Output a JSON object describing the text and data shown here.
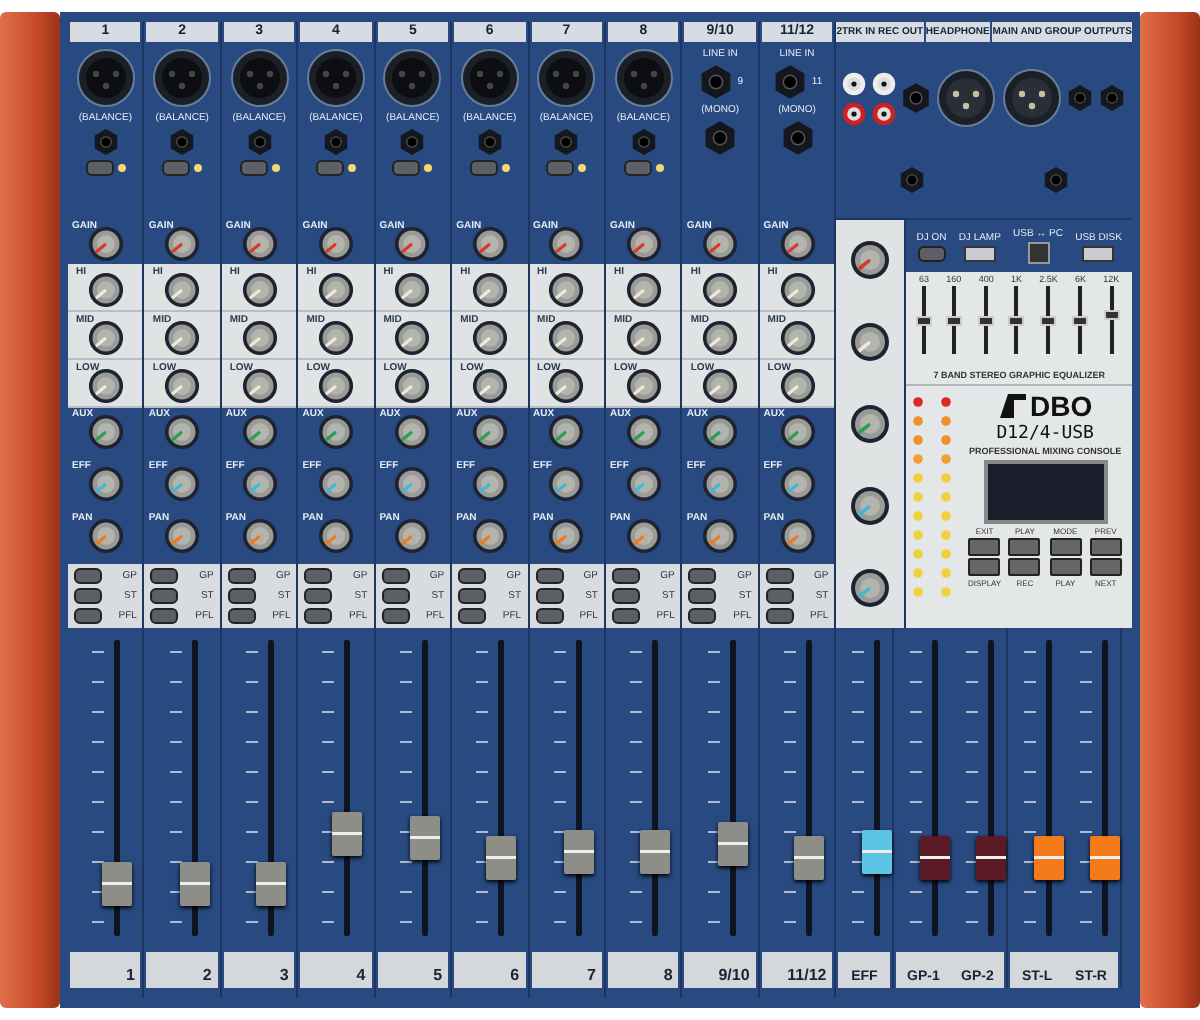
{
  "channels": [
    {
      "kind": "mono",
      "header": "1",
      "jack_label": "(BALANCE)",
      "pad_on": false,
      "knobs": [
        {
          "label": "GAIN",
          "kind": "gain",
          "color": "#d83a2a"
        },
        {
          "label": "HI",
          "kind": "eq",
          "color": "#efe8d8"
        },
        {
          "label": "MID",
          "kind": "eq",
          "color": "#efe8d8"
        },
        {
          "label": "LOW",
          "kind": "eq",
          "color": "#efe8d8"
        },
        {
          "label": "AUX",
          "kind": "send",
          "color": "#2aa050"
        },
        {
          "label": "EFF",
          "kind": "send",
          "color": "#40b8d8"
        },
        {
          "label": "PAN",
          "kind": "send",
          "color": "#f07a20"
        }
      ],
      "buttons": [
        {
          "label": "GP",
          "on": false
        },
        {
          "label": "ST",
          "on": false
        },
        {
          "label": "PFL",
          "on": false
        }
      ],
      "fader": {
        "level": 0.12
      },
      "label": "1"
    },
    {
      "kind": "mono",
      "header": "2",
      "jack_label": "(BALANCE)",
      "pad_on": false,
      "knobs": [
        {
          "label": "GAIN",
          "kind": "gain",
          "color": "#d83a2a"
        },
        {
          "label": "HI",
          "kind": "eq",
          "color": "#efe8d8"
        },
        {
          "label": "MID",
          "kind": "eq",
          "color": "#efe8d8"
        },
        {
          "label": "LOW",
          "kind": "eq",
          "color": "#efe8d8"
        },
        {
          "label": "AUX",
          "kind": "send",
          "color": "#2aa050"
        },
        {
          "label": "EFF",
          "kind": "send",
          "color": "#40b8d8"
        },
        {
          "label": "PAN",
          "kind": "send",
          "color": "#f07a20"
        }
      ],
      "buttons": [
        {
          "label": "GP",
          "on": false
        },
        {
          "label": "ST",
          "on": false
        },
        {
          "label": "PFL",
          "on": false
        }
      ],
      "fader": {
        "level": 0.12
      },
      "label": "2"
    },
    {
      "kind": "mono",
      "header": "3",
      "jack_label": "(BALANCE)",
      "pad_on": false,
      "knobs": [
        {
          "label": "GAIN",
          "kind": "gain",
          "color": "#d83a2a"
        },
        {
          "label": "HI",
          "kind": "eq",
          "color": "#efe8d8"
        },
        {
          "label": "MID",
          "kind": "eq",
          "color": "#efe8d8"
        },
        {
          "label": "LOW",
          "kind": "eq",
          "color": "#efe8d8"
        },
        {
          "label": "AUX",
          "kind": "send",
          "color": "#2aa050"
        },
        {
          "label": "EFF",
          "kind": "send",
          "color": "#40b8d8"
        },
        {
          "label": "PAN",
          "kind": "send",
          "color": "#f07a20"
        }
      ],
      "buttons": [
        {
          "label": "GP",
          "on": false
        },
        {
          "label": "ST",
          "on": false
        },
        {
          "label": "PFL",
          "on": false
        }
      ],
      "fader": {
        "level": 0.12
      },
      "label": "3"
    },
    {
      "kind": "mono",
      "header": "4",
      "jack_label": "(BALANCE)",
      "pad_on": false,
      "knobs": [
        {
          "label": "GAIN",
          "kind": "gain",
          "color": "#d83a2a"
        },
        {
          "label": "HI",
          "kind": "eq",
          "color": "#efe8d8"
        },
        {
          "label": "MID",
          "kind": "eq",
          "color": "#efe8d8"
        },
        {
          "label": "LOW",
          "kind": "eq",
          "color": "#efe8d8"
        },
        {
          "label": "AUX",
          "kind": "send",
          "color": "#2aa050"
        },
        {
          "label": "EFF",
          "kind": "send",
          "color": "#40b8d8"
        },
        {
          "label": "PAN",
          "kind": "send",
          "color": "#f07a20"
        }
      ],
      "buttons": [
        {
          "label": "GP",
          "on": false
        },
        {
          "label": "ST",
          "on": false
        },
        {
          "label": "PFL",
          "on": false
        }
      ],
      "fader": {
        "level": 0.32
      },
      "label": "4"
    },
    {
      "kind": "mono",
      "header": "5",
      "jack_label": "(BALANCE)",
      "pad_on": false,
      "knobs": [
        {
          "label": "GAIN",
          "kind": "gain",
          "color": "#d83a2a"
        },
        {
          "label": "HI",
          "kind": "eq",
          "color": "#efe8d8"
        },
        {
          "label": "MID",
          "kind": "eq",
          "color": "#efe8d8"
        },
        {
          "label": "LOW",
          "kind": "eq",
          "color": "#efe8d8"
        },
        {
          "label": "AUX",
          "kind": "send",
          "color": "#2aa050"
        },
        {
          "label": "EFF",
          "kind": "send",
          "color": "#40b8d8"
        },
        {
          "label": "PAN",
          "kind": "send",
          "color": "#f07a20"
        }
      ],
      "buttons": [
        {
          "label": "GP",
          "on": false
        },
        {
          "label": "ST",
          "on": false
        },
        {
          "label": "PFL",
          "on": false
        }
      ],
      "fader": {
        "level": 0.3
      },
      "label": "5"
    },
    {
      "kind": "mono",
      "header": "6",
      "jack_label": "(BALANCE)",
      "pad_on": false,
      "knobs": [
        {
          "label": "GAIN",
          "kind": "gain",
          "color": "#d83a2a"
        },
        {
          "label": "HI",
          "kind": "eq",
          "color": "#efe8d8"
        },
        {
          "label": "MID",
          "kind": "eq",
          "color": "#efe8d8"
        },
        {
          "label": "LOW",
          "kind": "eq",
          "color": "#efe8d8"
        },
        {
          "label": "AUX",
          "kind": "send",
          "color": "#2aa050"
        },
        {
          "label": "EFF",
          "kind": "send",
          "color": "#40b8d8"
        },
        {
          "label": "PAN",
          "kind": "send",
          "color": "#f07a20"
        }
      ],
      "buttons": [
        {
          "label": "GP",
          "on": false
        },
        {
          "label": "ST",
          "on": false
        },
        {
          "label": "PFL",
          "on": false
        }
      ],
      "fader": {
        "level": 0.22
      },
      "label": "6"
    },
    {
      "kind": "mono",
      "header": "7",
      "jack_label": "(BALANCE)",
      "pad_on": false,
      "knobs": [
        {
          "label": "GAIN",
          "kind": "gain",
          "color": "#d83a2a"
        },
        {
          "label": "HI",
          "kind": "eq",
          "color": "#efe8d8"
        },
        {
          "label": "MID",
          "kind": "eq",
          "color": "#efe8d8"
        },
        {
          "label": "LOW",
          "kind": "eq",
          "color": "#efe8d8"
        },
        {
          "label": "AUX",
          "kind": "send",
          "color": "#2aa050"
        },
        {
          "label": "EFF",
          "kind": "send",
          "color": "#40b8d8"
        },
        {
          "label": "PAN",
          "kind": "send",
          "color": "#f07a20"
        }
      ],
      "buttons": [
        {
          "label": "GP",
          "on": false
        },
        {
          "label": "ST",
          "on": false
        },
        {
          "label": "PFL",
          "on": false
        }
      ],
      "fader": {
        "level": 0.25
      },
      "label": "7"
    },
    {
      "kind": "mono",
      "header": "8",
      "jack_label": "(BALANCE)",
      "pad_on": false,
      "knobs": [
        {
          "label": "GAIN",
          "kind": "gain",
          "color": "#d83a2a"
        },
        {
          "label": "HI",
          "kind": "eq",
          "color": "#efe8d8"
        },
        {
          "label": "MID",
          "kind": "eq",
          "color": "#efe8d8"
        },
        {
          "label": "LOW",
          "kind": "eq",
          "color": "#efe8d8"
        },
        {
          "label": "AUX",
          "kind": "send",
          "color": "#2aa050"
        },
        {
          "label": "EFF",
          "kind": "send",
          "color": "#40b8d8"
        },
        {
          "label": "PAN",
          "kind": "send",
          "color": "#f07a20"
        }
      ],
      "buttons": [
        {
          "label": "GP",
          "on": false
        },
        {
          "label": "ST",
          "on": false
        },
        {
          "label": "PFL",
          "on": false
        }
      ],
      "fader": {
        "level": 0.25
      },
      "label": "8"
    },
    {
      "kind": "stereo",
      "header": "9/10",
      "line_label": "LINE IN",
      "jack_number": "9",
      "mono_label": "(MONO)",
      "knobs": [
        {
          "label": "GAIN",
          "kind": "gain",
          "color": "#d83a2a"
        },
        {
          "label": "HI",
          "kind": "eq",
          "color": "#efe8d8"
        },
        {
          "label": "MID",
          "kind": "eq",
          "color": "#efe8d8"
        },
        {
          "label": "LOW",
          "kind": "eq",
          "color": "#efe8d8"
        },
        {
          "label": "AUX",
          "kind": "send",
          "color": "#2aa050"
        },
        {
          "label": "EFF",
          "kind": "send",
          "color": "#40b8d8"
        },
        {
          "label": "PAN",
          "kind": "send",
          "color": "#f07a20"
        }
      ],
      "buttons": [
        {
          "label": "GP",
          "on": false
        },
        {
          "label": "ST",
          "on": false
        },
        {
          "label": "PFL",
          "on": false
        }
      ],
      "fader": {
        "level": 0.28
      },
      "label": "9/10"
    },
    {
      "kind": "stereo",
      "header": "11/12",
      "line_label": "LINE IN",
      "jack_number": "11",
      "mono_label": "(MONO)",
      "knobs": [
        {
          "label": "GAIN",
          "kind": "gain",
          "color": "#d83a2a"
        },
        {
          "label": "HI",
          "kind": "eq",
          "color": "#efe8d8"
        },
        {
          "label": "MID",
          "kind": "eq",
          "color": "#efe8d8"
        },
        {
          "label": "LOW",
          "kind": "eq",
          "color": "#efe8d8"
        },
        {
          "label": "AUX",
          "kind": "send",
          "color": "#2aa050"
        },
        {
          "label": "EFF",
          "kind": "send",
          "color": "#40b8d8"
        },
        {
          "label": "PAN",
          "kind": "send",
          "color": "#f07a20"
        }
      ],
      "buttons": [
        {
          "label": "GP",
          "on": false
        },
        {
          "label": "ST",
          "on": false
        },
        {
          "label": "PFL",
          "on": false
        }
      ],
      "fader": {
        "level": 0.22
      },
      "label": "11/12"
    }
  ],
  "master": {
    "headers": [
      "2TRK IN REC OUT",
      "HEADPHONE",
      "MAIN AND GROUP OUTPUTS"
    ],
    "knobs": [
      {
        "color": "#d83a2a"
      },
      {
        "color": "#efe8d8"
      },
      {
        "color": "#2aa050"
      },
      {
        "color": "#40b8d8"
      },
      {
        "color": "#40b8d8"
      }
    ],
    "usb": [
      {
        "label": "DJ ON",
        "kind": "button",
        "on": false
      },
      {
        "label": "DJ LAMP",
        "kind": "port"
      },
      {
        "label": "USB ↔ PC",
        "kind": "usb-b"
      },
      {
        "label": "USB DISK",
        "kind": "port"
      }
    ],
    "eq": {
      "title": "7 BAND STEREO GRAPHIC EQUALIZER",
      "bands": [
        {
          "freq": "63",
          "level": 0.5
        },
        {
          "freq": "160",
          "level": 0.5
        },
        {
          "freq": "400",
          "level": 0.5
        },
        {
          "freq": "1K",
          "level": 0.5
        },
        {
          "freq": "2.5K",
          "level": 0.5
        },
        {
          "freq": "6K",
          "level": 0.5
        },
        {
          "freq": "12K",
          "level": 0.6
        }
      ]
    },
    "brand": "DBO",
    "model": "D12/4-USB",
    "subtitle": "PROFESSIONAL MIXING CONSOLE",
    "player_buttons": [
      "EXIT",
      "PLAY",
      "MODE",
      "PREV",
      "DISPLAY",
      "REC",
      "PLAY",
      "NEXT"
    ],
    "output_groups": [
      {
        "faders": [
          {
            "label": "EFF",
            "level": 0.25,
            "color": "#5cc4e4"
          }
        ]
      },
      {
        "faders": [
          {
            "label": "GP-1",
            "level": 0.22,
            "color": "#5a1a26"
          },
          {
            "label": "GP-2",
            "level": 0.22,
            "color": "#5a1a26"
          }
        ]
      },
      {
        "faders": [
          {
            "label": "ST-L",
            "level": 0.22,
            "color": "#f57a1a"
          },
          {
            "label": "ST-R",
            "level": 0.22,
            "color": "#f57a1a"
          }
        ]
      }
    ]
  }
}
